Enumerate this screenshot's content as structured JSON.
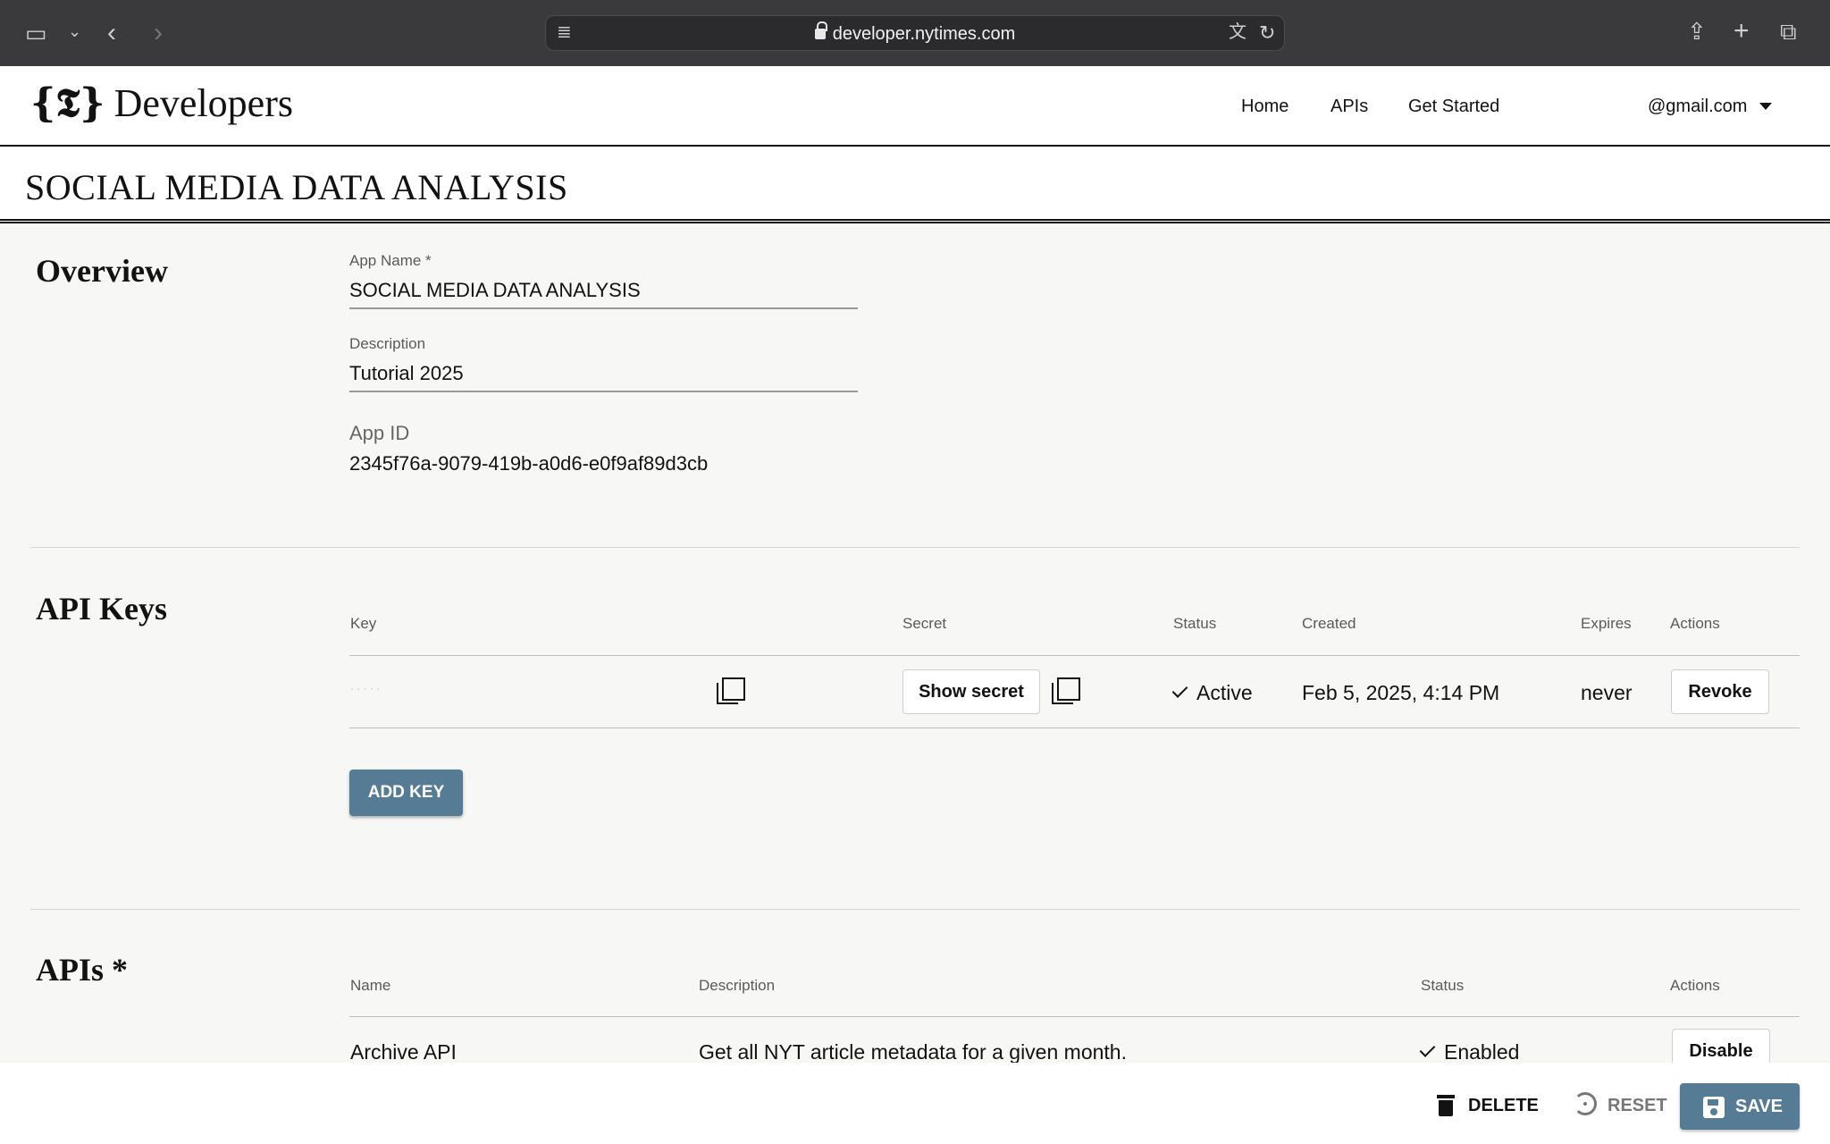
{
  "browser": {
    "url": "developer.nytimes.com",
    "icons": [
      "sidebar-icon",
      "chevron-down-icon",
      "back-icon",
      "forward-icon",
      "reader-icon",
      "lock-icon",
      "translate-icon",
      "reload-icon",
      "share-icon",
      "new-tab-icon",
      "tabs-icon"
    ]
  },
  "header": {
    "logo_mark": "{𝕿}",
    "logo_text": "Developers",
    "nav": [
      "Home",
      "APIs",
      "Get Started"
    ],
    "account": "@gmail.com"
  },
  "page": {
    "title": "SOCIAL MEDIA DATA ANALYSIS"
  },
  "overview": {
    "heading": "Overview",
    "app_name_label": "App Name *",
    "app_name_value": "SOCIAL MEDIA DATA ANALYSIS",
    "description_label": "Description",
    "description_value": "Tutorial 2025",
    "app_id_label": "App ID",
    "app_id_value": "2345f76a-9079-419b-a0d6-e0f9af89d3cb"
  },
  "api_keys": {
    "heading": "API Keys",
    "columns": [
      "Key",
      "Secret",
      "Status",
      "Created",
      "Expires",
      "Actions"
    ],
    "rows": [
      {
        "key": "· · · · ·",
        "secret_button": "Show secret",
        "status": "Active",
        "created": "Feb 5, 2025, 4:14 PM",
        "expires": "never",
        "action": "Revoke"
      }
    ],
    "add_button": "ADD KEY"
  },
  "apis": {
    "heading": "APIs *",
    "columns": [
      "Name",
      "Description",
      "Status",
      "Actions"
    ],
    "rows": [
      {
        "name": "Archive API",
        "description": "Get all NYT article metadata for a given month.",
        "status": "Enabled",
        "action": "Disable"
      }
    ]
  },
  "footer_actions": {
    "delete": "DELETE",
    "reset": "RESET",
    "save": "SAVE"
  },
  "colors": {
    "primary_button": "#567b95",
    "chrome_bg": "#3a3a3c",
    "page_bg": "#f7f7f5"
  }
}
